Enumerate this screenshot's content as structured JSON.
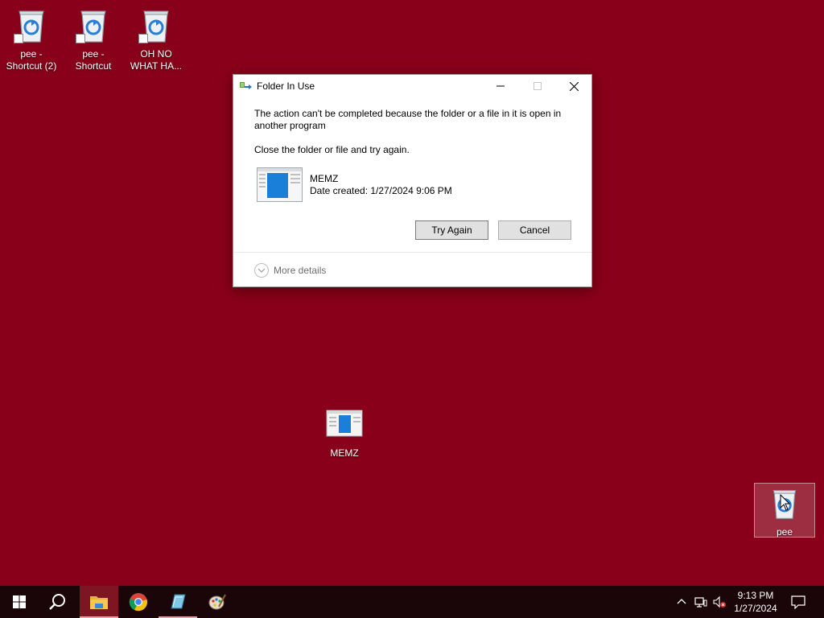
{
  "desktop": {
    "icons": [
      {
        "label": "pee -\nShortcut (2)"
      },
      {
        "label": "pee -\nShortcut"
      },
      {
        "label": "OH NO\nWHAT HA..."
      },
      {
        "label": "MEMZ"
      },
      {
        "label": "pee"
      }
    ]
  },
  "dialog": {
    "title": "Folder In Use",
    "message": "The action can't be completed because the folder or a file in it is open in another program",
    "instruction": "Close the folder or file and try again.",
    "file_name": "MEMZ",
    "file_date": "Date created: 1/27/2024 9:06 PM",
    "try_again_label": "Try Again",
    "cancel_label": "Cancel",
    "more_details_label": "More details"
  },
  "taskbar": {
    "items": [
      "start-icon",
      "search-icon",
      "file-explorer-icon",
      "chrome-icon",
      "notepad-icon",
      "paint-icon"
    ],
    "active_item": "file-explorer-icon",
    "time": "9:13 PM",
    "date": "1/27/2024"
  },
  "colors": {
    "desktop_background": "#880019",
    "taskbar": "#1a0509"
  }
}
